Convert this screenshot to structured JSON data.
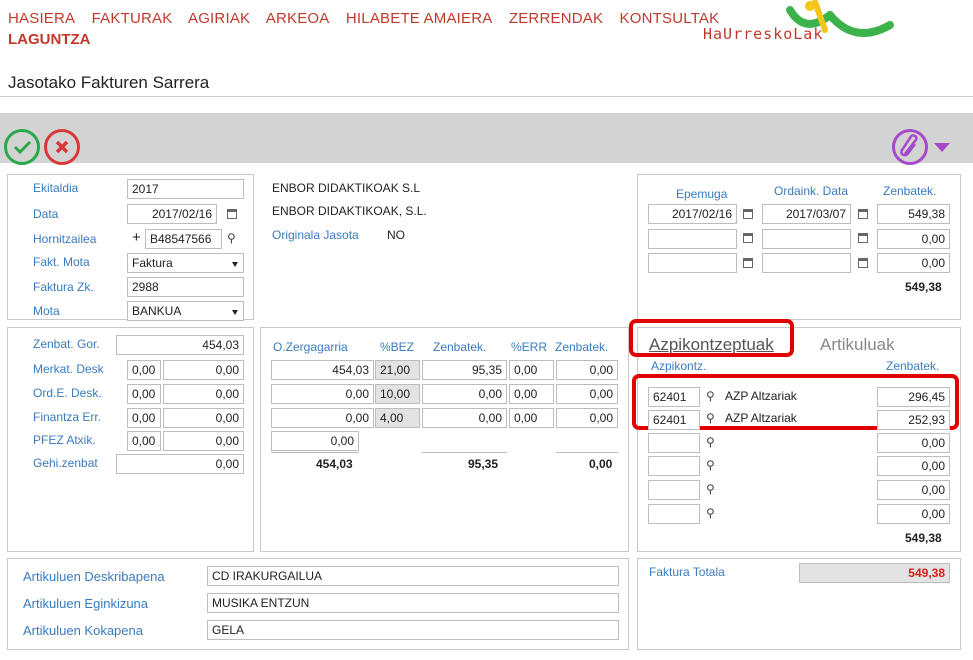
{
  "menu": {
    "items": [
      "HASIERA",
      "FAKTURAK",
      "AGIRIAK",
      "ARKEOA",
      "HILABETE AMAIERA",
      "ZERRENDAK",
      "KONTSULTAK"
    ],
    "second_line": "LAGUNTZA"
  },
  "logo": {
    "text": "HaUrreskoLak"
  },
  "page": {
    "title": "Jasotako Fakturen Sarrera"
  },
  "header_form": {
    "ekitaldia_label": "Ekitaldia",
    "ekitaldia": "2017",
    "data_label": "Data",
    "data": "2017/02/16",
    "hornitzailea_label": "Hornitzailea",
    "hornitzailea": "B48547566",
    "fakt_mota_label": "Fakt. Mota",
    "fakt_mota": "Faktura",
    "faktura_zk_label": "Faktura Zk.",
    "faktura_zk": "2988",
    "mota_label": "Mota",
    "mota": "BANKUA"
  },
  "supplier": {
    "name1": "ENBOR DIDAKTIKOAK S.L",
    "name2": "ENBOR DIDAKTIKOAK, S.L.",
    "originala_label": "Originala Jasota",
    "originala_value": "NO"
  },
  "payments": {
    "headers": [
      "Epemuga",
      "Ordaink. Data",
      "Zenbatek."
    ],
    "rows": [
      {
        "epemuga": "2017/02/16",
        "ordaink": "2017/03/07",
        "zenbatek": "549,38"
      },
      {
        "epemuga": "",
        "ordaink": "",
        "zenbatek": "0,00"
      },
      {
        "epemuga": "",
        "ordaink": "",
        "zenbatek": "0,00"
      }
    ],
    "total": "549,38"
  },
  "amounts": {
    "zenbat_gor_label": "Zenbat. Gor.",
    "zenbat_gor": "454,03",
    "rows": [
      {
        "label": "Merkat. Desk",
        "pct": "0,00",
        "value": "0,00"
      },
      {
        "label": "Ord.E. Desk.",
        "pct": "0,00",
        "value": "0,00"
      },
      {
        "label": "Finantza Err.",
        "pct": "0,00",
        "value": "0,00"
      },
      {
        "label": "PFEZ Atxik.",
        "pct": "0,00",
        "value": "0,00"
      }
    ],
    "gehi_label": "Gehi.zenbat",
    "gehi": "0,00"
  },
  "vat": {
    "headers": [
      "O.Zergagarria",
      "%BEZ",
      "Zenbatek.",
      "%ERR",
      "Zenbatek."
    ],
    "rows": [
      {
        "base": "454,03",
        "bez": "21,00",
        "amount": "95,35",
        "err": "0,00",
        "err_amount": "0,00"
      },
      {
        "base": "0,00",
        "bez": "10,00",
        "amount": "0,00",
        "err": "0,00",
        "err_amount": "0,00"
      },
      {
        "base": "0,00",
        "bez": "4,00",
        "amount": "0,00",
        "err": "0,00",
        "err_amount": "0,00"
      }
    ],
    "extra_base": "0,00",
    "totals": {
      "base": "454,03",
      "amount": "95,35",
      "err_amount": "0,00"
    }
  },
  "concepts": {
    "tab_active": "Azpikontzeptuak",
    "tab_inactive": "Artikuluak",
    "col_left": "Azpikontz.",
    "col_right": "Zenbatek.",
    "rows": [
      {
        "code": "62401",
        "name": "AZP Altzariak",
        "amount": "296,45"
      },
      {
        "code": "62401",
        "name": "AZP Altzariak",
        "amount": "252,93"
      }
    ],
    "empty_amounts": [
      "0,00",
      "0,00",
      "0,00",
      "0,00"
    ],
    "total": "549,38"
  },
  "articles": {
    "deskribapena_label": "Artikuluen Deskribapena",
    "deskribapena": "CD IRAKURGAILUA",
    "eginkizuna_label": "Artikuluen Eginkizuna",
    "eginkizuna": "MUSIKA ENTZUN",
    "kokapena_label": "Artikuluen Kokapena",
    "kokapena": "GELA"
  },
  "invoice_total": {
    "label": "Faktura Totala",
    "value": "549,38"
  },
  "colors": {
    "menu": "#c0392b",
    "label": "#3a7bbf",
    "highlight": "#e00000",
    "ok": "#2aa84a",
    "cancel": "#d9383a",
    "attach": "#a64ac9"
  },
  "icons": {
    "ok": "check-circle-icon",
    "cancel": "x-circle-icon",
    "attach": "paperclip-icon",
    "search": "search-icon",
    "calendar": "calendar-icon"
  }
}
